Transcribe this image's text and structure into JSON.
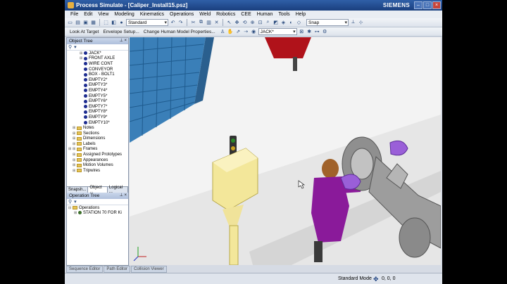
{
  "window": {
    "title": "Process Simulate - [Caliper_Install15.psz]",
    "brand": "SIEMENS"
  },
  "menu": [
    "File",
    "Edit",
    "View",
    "Modeling",
    "Kinematics",
    "Operations",
    "Weld",
    "Robotics",
    "CEE",
    "Human",
    "Tools",
    "Help"
  ],
  "toolbar1": {
    "view_combo": "Standard",
    "snap_combo": "Snap"
  },
  "toolbar2": {
    "links": [
      "Look At Target",
      "Envelope Setup...",
      "Change Human Model Properties..."
    ],
    "object_combo": "JACK*"
  },
  "object_tree": {
    "header": "Object Tree",
    "items": [
      "JACK*",
      "FRONT AXLE",
      "WIRE CONT",
      "CONVEYOR",
      "BOX - BOLT1",
      "EMPTY2*",
      "EMPTY3*",
      "EMPTY4*",
      "EMPTY5*",
      "EMPTY6*",
      "EMPTY7*",
      "EMPTY8*",
      "EMPTY9*",
      "EMPTY10*"
    ],
    "folders": [
      "Notes",
      "Sections",
      "Dimensions",
      "Labels",
      "Frames",
      "Assigned Prototypes",
      "Appearances",
      "Motion Volumes",
      "Tripwires"
    ]
  },
  "panel_tabs": [
    "Snapsh...",
    "Object ...",
    "Logical ..."
  ],
  "operation_tree": {
    "header": "Operation Tree",
    "items": [
      "Operations",
      "STATION 70 FOR Ki"
    ]
  },
  "bottom_tabs": [
    "Sequence Editor",
    "Path Editor",
    "Collision Viewer"
  ],
  "status": {
    "mode": "Standard Mode",
    "coords": "0, 0, 0"
  },
  "colors": {
    "title_bar": "#1a3f7e",
    "robot_part": "#9a5fd8",
    "human_shirt": "#8a1a9a",
    "cage": "#2a6ea8",
    "cabinet": "#f3e79a"
  }
}
